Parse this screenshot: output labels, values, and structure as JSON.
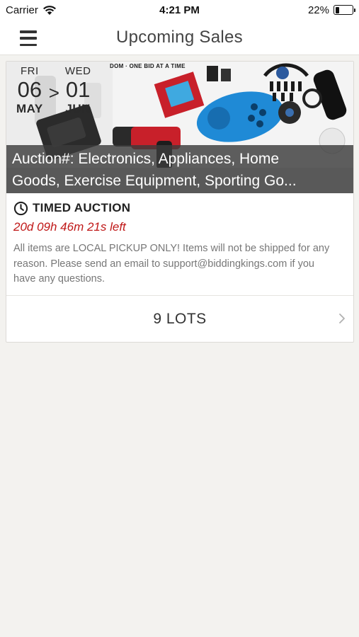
{
  "status_bar": {
    "carrier": "Carrier",
    "time": "4:21 PM",
    "battery_percent": "22%",
    "battery_level": 0.22
  },
  "nav": {
    "title": "Upcoming Sales"
  },
  "sale": {
    "start": {
      "weekday": "FRI",
      "day": "06",
      "month": "MAY"
    },
    "separator": ">",
    "end": {
      "weekday": "WED",
      "day": "01",
      "month": "JUN"
    },
    "banner_text": "DOM · ONE BID AT A TIME",
    "title_line1": "Auction#: Electronics, Appliances, Home",
    "title_line2": "Goods, Exercise Equipment, Sporting Go...",
    "auction_type": "TIMED AUCTION",
    "countdown": "20d 09h 46m 21s left",
    "description": "All items are LOCAL PICKUP ONLY! Items will not be shipped for any reason. Please send an email to support@biddingkings.com if you have any questions.",
    "lots_label": "9 LOTS"
  },
  "colors": {
    "countdown": "#c01818",
    "controller_blue": "#1f8ad6",
    "drill_red": "#c8202a"
  },
  "icons": [
    "wifi-icon",
    "battery-icon",
    "menu-icon",
    "clock-icon",
    "chevron-right-icon"
  ]
}
